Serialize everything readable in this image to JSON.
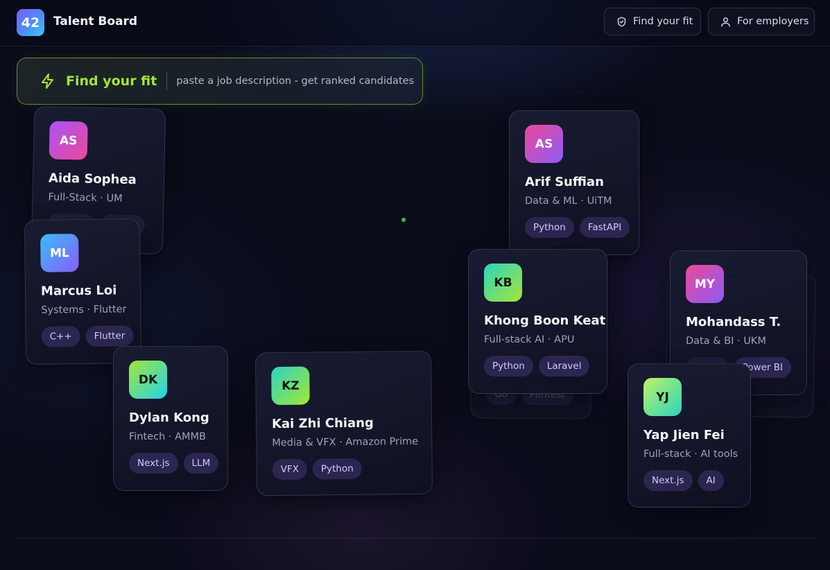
{
  "header": {
    "logo_badge": "42",
    "logo_text": "Talent Board",
    "find_fit_label": "Find your fit",
    "employers_label": "For employers"
  },
  "banner": {
    "title": "Find your fit",
    "subtitle": "paste a job description - get ranked candidates"
  },
  "cards": {
    "aida": {
      "initials": "AS",
      "name": "Aida Sophea",
      "role": "Full-Stack · UM"
    },
    "marcus": {
      "initials": "ML",
      "name": "Marcus Loi",
      "role": "Systems · Flutter",
      "tags": [
        "C++",
        "Flutter"
      ]
    },
    "dylan": {
      "initials": "DK",
      "name": "Dylan Kong",
      "role": "Fintech · AMMB",
      "tags": [
        "Next.js",
        "LLM"
      ]
    },
    "kai": {
      "initials": "KZ",
      "name": "Kai Zhi Chiang",
      "role": "Media & VFX · Amazon Prime",
      "tags": [
        "VFX",
        "Python"
      ]
    },
    "arif": {
      "initials": "AS",
      "name": "Arif Suffian",
      "role": "Data & ML · UiTM",
      "tags": [
        "Python",
        "FastAPI"
      ]
    },
    "khong": {
      "initials": "KB",
      "name": "Khong Boon Keat",
      "role": "Full-stack AI · APU",
      "tags": [
        "Python",
        "Laravel"
      ]
    },
    "hidden_behind_khong": {
      "tags": [
        "Go",
        "Pentest"
      ]
    },
    "mohandass": {
      "initials": "MY",
      "name": "Mohandass T.",
      "role": "Data & BI · UKM",
      "tags": [
        "Power BI"
      ]
    },
    "yap": {
      "initials": "YJ",
      "name": "Yap Jien Fei",
      "role": "Full-stack · AI tools",
      "tags": [
        "Next.js",
        "AI"
      ]
    }
  },
  "colors": {
    "accent_green": "#a3e635",
    "tag_bg": "#2a2650",
    "tag_text": "#d3c9ff",
    "background": "#0a0c1a"
  }
}
